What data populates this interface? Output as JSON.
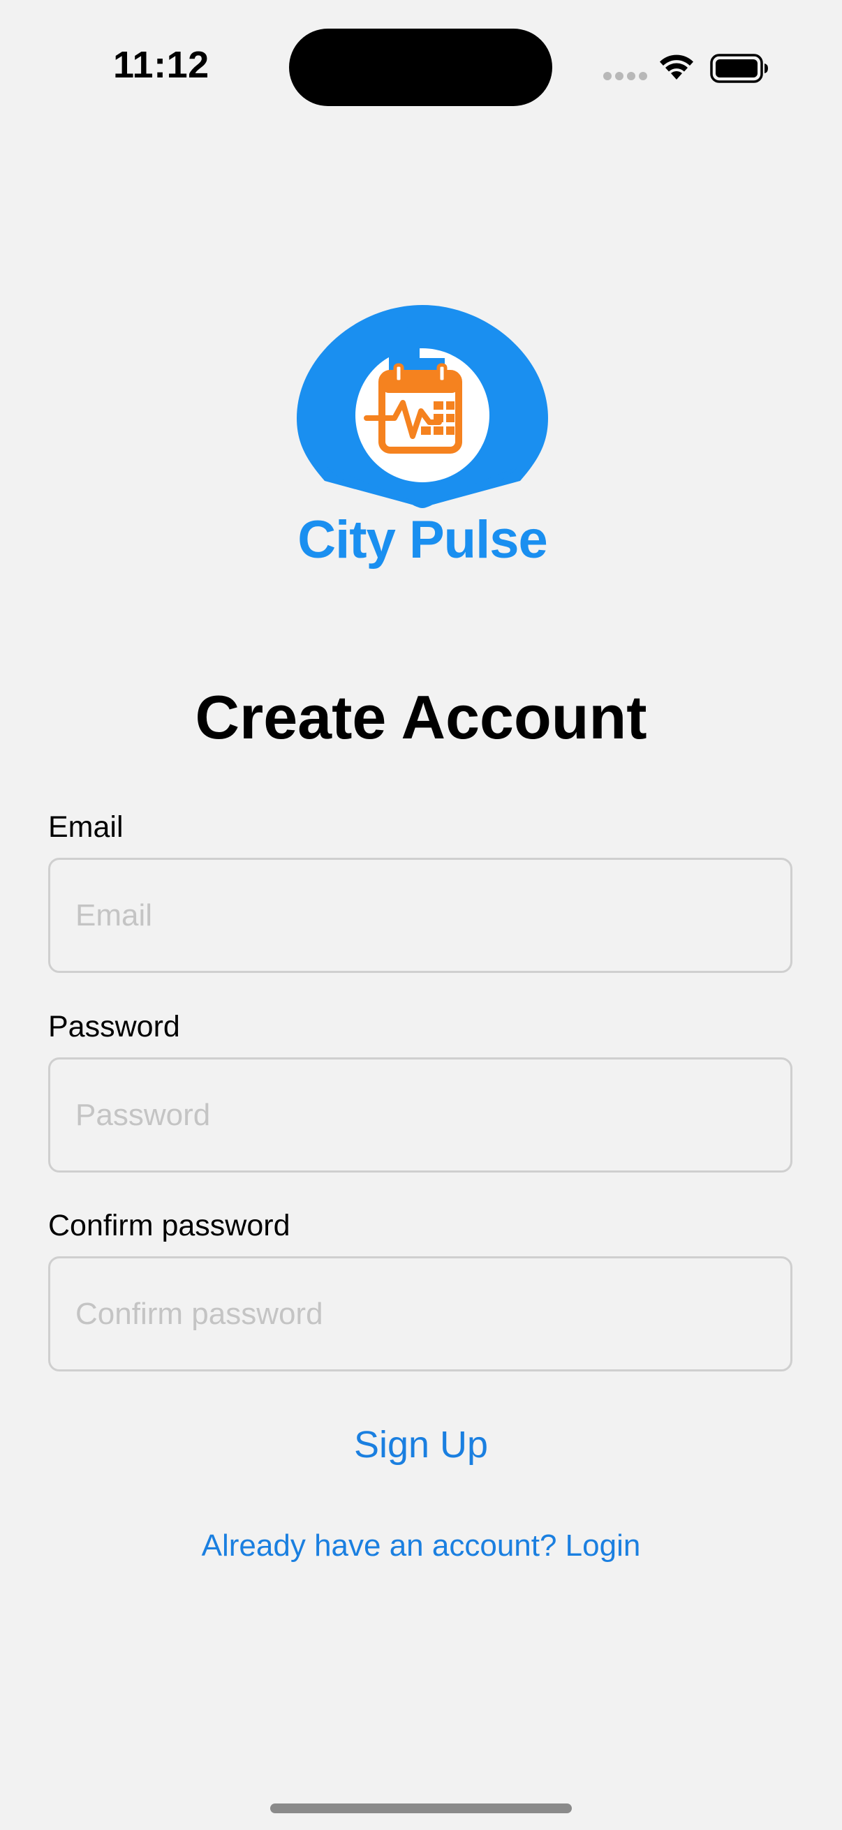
{
  "status_bar": {
    "time": "11:12"
  },
  "logo": {
    "brand_name": "City Pulse",
    "primary_color": "#1a8ff0",
    "accent_color": "#f5821f"
  },
  "form": {
    "title": "Create Account",
    "email": {
      "label": "Email",
      "placeholder": "Email",
      "value": ""
    },
    "password": {
      "label": "Password",
      "placeholder": "Password",
      "value": ""
    },
    "confirm_password": {
      "label": "Confirm password",
      "placeholder": "Confirm password",
      "value": ""
    },
    "signup_label": "Sign Up",
    "login_link_label": "Already have an account? Login"
  },
  "colors": {
    "background": "#f2f2f2",
    "link": "#1a7fe0",
    "field_border": "#cfcfcf",
    "placeholder": "#c4c4c4"
  }
}
